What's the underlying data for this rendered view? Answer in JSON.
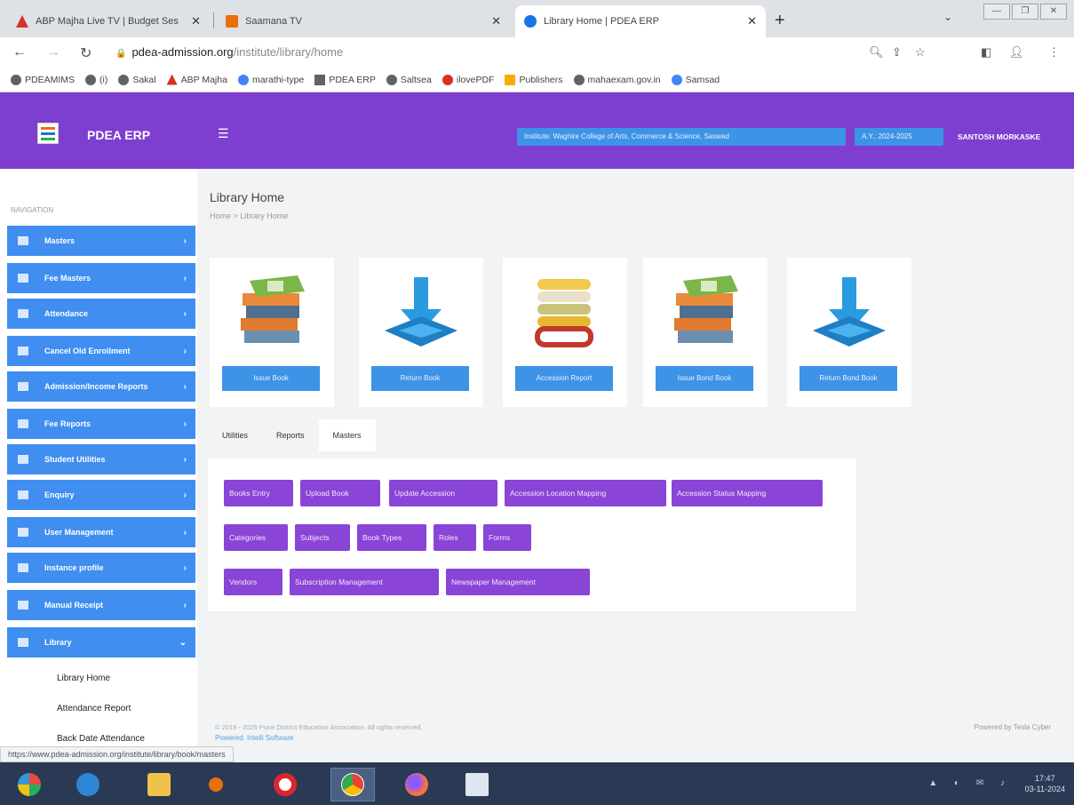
{
  "browser": {
    "tabs": [
      {
        "title": "ABP Majha Live TV | Budget Ses",
        "favicon_color": "#d93025"
      },
      {
        "title": "Saamana TV",
        "favicon_color": "#e8710a"
      },
      {
        "title": "Library Home | PDEA ERP",
        "favicon_color": "#1a73e8"
      }
    ],
    "url_host": "pdea-admission.org",
    "url_path": "/institute/library/home",
    "bookmarks": [
      {
        "label": "PDEAMIMS",
        "color": "#5f6368"
      },
      {
        "label": "(i)",
        "color": "#5f6368"
      },
      {
        "label": "Sakal",
        "color": "#5f6368"
      },
      {
        "label": "ABP Majha",
        "color": "#d93025"
      },
      {
        "label": "marathi-type",
        "color": "#4285f4"
      },
      {
        "label": "PDEA ERP",
        "color": "#5f6368"
      },
      {
        "label": "Saltsea",
        "color": "#5f6368"
      },
      {
        "label": "ilovePDF",
        "color": "#d93025"
      },
      {
        "label": "Publishers",
        "color": "#f9ab00"
      },
      {
        "label": "mahaexam.gov.in",
        "color": "#5f6368"
      },
      {
        "label": "Samsad",
        "color": "#4285f4"
      }
    ],
    "status_url": "https://www.pdea-admission.org/institute/library/book/masters"
  },
  "header": {
    "brand": "PDEA ERP",
    "institute": "Institute: Waghire College of Arts, Commerce & Science, Saswad",
    "year": "A.Y.: 2024-2025",
    "user": "SANTOSH MORKASKE",
    "accent": "#7e3fd0"
  },
  "sidebar": {
    "title": "NAVIGATION",
    "items": [
      {
        "label": "Masters"
      },
      {
        "label": "Fee Masters"
      },
      {
        "label": "Attendance"
      },
      {
        "label": "Cancel Old Enrollment"
      },
      {
        "label": "Admission/Income Reports"
      },
      {
        "label": "Fee Reports"
      },
      {
        "label": "Student Utilities"
      },
      {
        "label": "Enquiry"
      },
      {
        "label": "User Management"
      },
      {
        "label": "Instance profile"
      },
      {
        "label": "Manual Receipt"
      },
      {
        "label": "Library"
      }
    ],
    "submenu": [
      {
        "label": "Library Home"
      },
      {
        "label": "Attendance Report"
      },
      {
        "label": "Back Date Attendance"
      }
    ]
  },
  "main": {
    "title": "Library Home",
    "breadcrumb": "Home  >  Library Home",
    "cards": [
      {
        "label": "Issue Book",
        "icon": "books-stack-icon"
      },
      {
        "label": "Return Book",
        "icon": "download-arrow-icon"
      },
      {
        "label": "Accession Report",
        "icon": "books-upright-icon"
      },
      {
        "label": "Issue Bond Book",
        "icon": "books-stack-icon"
      },
      {
        "label": "Return Bond Book",
        "icon": "download-arrow-icon"
      }
    ],
    "tabs": [
      {
        "label": "Utilities"
      },
      {
        "label": "Reports"
      },
      {
        "label": "Masters"
      }
    ],
    "masters_buttons": [
      {
        "label": "Books Entry"
      },
      {
        "label": "Upload Book"
      },
      {
        "label": "Update Accession"
      },
      {
        "label": "Accession Location Mapping"
      },
      {
        "label": "Accession Status Mapping"
      },
      {
        "label": "Categories"
      },
      {
        "label": "Subjects"
      },
      {
        "label": "Book Types"
      },
      {
        "label": "Roles"
      },
      {
        "label": "Forms"
      },
      {
        "label": "Vendors"
      },
      {
        "label": "Subscription Management"
      },
      {
        "label": "Newspaper Management"
      }
    ],
    "footer_copyright": "© 2019 - 2025 Pune District Education Association. All rights reserved.",
    "footer_link": "Powered: Intelli Software",
    "footer_right": "Powered by Tesla Cyber"
  },
  "taskbar": {
    "time": "17:47",
    "date": "03-11-2024"
  }
}
